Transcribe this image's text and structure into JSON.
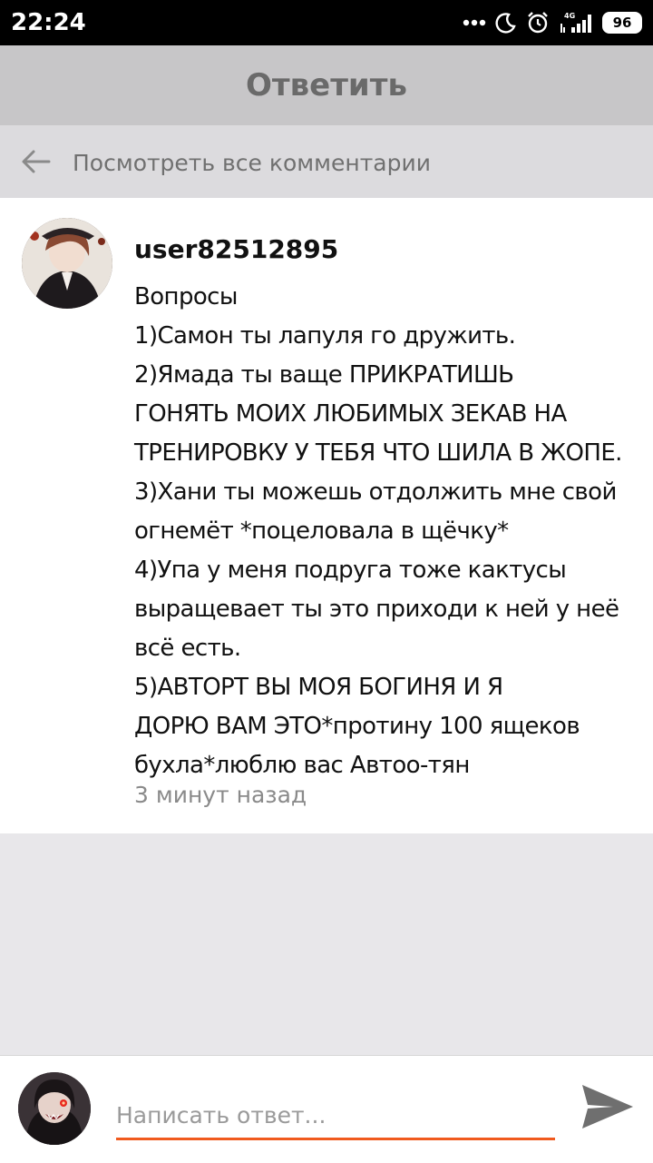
{
  "status_bar": {
    "time": "22:24",
    "battery": "96",
    "network": "4G"
  },
  "header": {
    "title": "Ответить"
  },
  "view_all": {
    "label": "Посмотреть все комментарии"
  },
  "comment": {
    "username": "user82512895",
    "lines": [
      "Вопросы",
      "1)Самон ты лапуля го дружить.",
      "2)Ямада ты ваще ПРИКРАТИШЬ",
      "ГОНЯТЬ МОИХ ЛЮБИМЫХ ЗЕКАВ НА",
      "ТРЕНИРОВКУ У ТЕБЯ ЧТО ШИЛА В ЖОПЕ.",
      "3)Хани ты можешь отдолжить мне свой",
      "огнемёт *поцеловала в щёчку*",
      "4)Упа у меня подруга тоже кактусы",
      "выращевает  ты это приходи к ней у неё",
      "всё есть.",
      "5)АВТОРТ ВЫ МОЯ БОГИНЯ И Я",
      "ДОРЮ ВАМ ЭТО*протину 100 ящеков",
      "бухла*люблю вас Автоо-тян"
    ],
    "timestamp": "3 минут назад"
  },
  "composer": {
    "placeholder": "Написать ответ..."
  },
  "icons": {
    "back": "arrow-left-icon",
    "send": "send-icon",
    "more": "more-dots-icon",
    "dnd": "moon-icon",
    "alarm": "alarm-icon",
    "signal": "signal-icon",
    "battery": "battery-icon"
  },
  "colors": {
    "accent": "#f05a1e",
    "header_bg": "#c7c6c8",
    "page_bg": "#e8e7ea"
  }
}
